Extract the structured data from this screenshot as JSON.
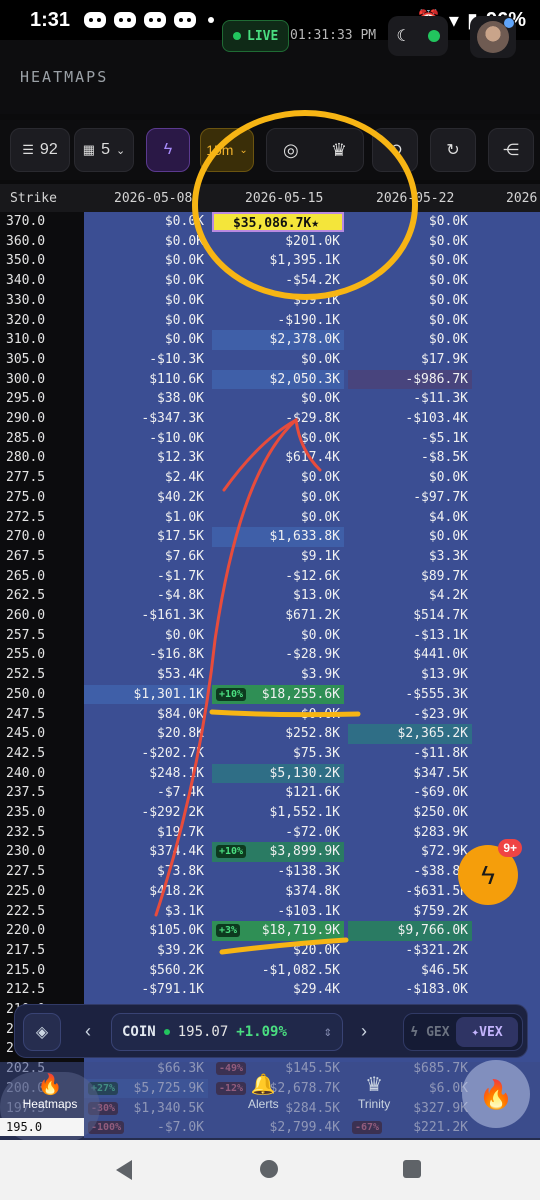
{
  "status_bar": {
    "time": "1:31",
    "battery": "96%"
  },
  "header": {
    "title": "HEATMAPS",
    "live_label": "LIVE",
    "clock": "01:31:33 PM"
  },
  "toolbar": {
    "count": "92",
    "days": "5",
    "timeframe": "15m"
  },
  "columns": {
    "strike": "Strike",
    "dates": [
      "2026-05-08",
      "2026-05-15",
      "2026-05-22",
      "2026"
    ]
  },
  "rows": [
    {
      "k": "370.0",
      "v": [
        "$0.0K",
        "$35,086.7K★",
        "$0.0K"
      ]
    },
    {
      "k": "360.0",
      "v": [
        "$0.0K",
        "$201.0K",
        "$0.0K"
      ]
    },
    {
      "k": "350.0",
      "v": [
        "$0.0K",
        "$1,395.1K",
        "$0.0K"
      ]
    },
    {
      "k": "340.0",
      "v": [
        "$0.0K",
        "-$54.2K",
        "$0.0K"
      ]
    },
    {
      "k": "330.0",
      "v": [
        "$0.0K",
        "$59.1K",
        "$0.0K"
      ]
    },
    {
      "k": "320.0",
      "v": [
        "$0.0K",
        "-$190.1K",
        "$0.0K"
      ]
    },
    {
      "k": "310.0",
      "v": [
        "$0.0K",
        "$2,378.0K",
        "$0.0K"
      ]
    },
    {
      "k": "305.0",
      "v": [
        "-$10.3K",
        "$0.0K",
        "$17.9K"
      ]
    },
    {
      "k": "300.0",
      "v": [
        "$110.6K",
        "$2,050.3K",
        "-$986.7K"
      ]
    },
    {
      "k": "295.0",
      "v": [
        "$38.0K",
        "$0.0K",
        "-$11.3K"
      ]
    },
    {
      "k": "290.0",
      "v": [
        "-$347.3K",
        "-$29.8K",
        "-$103.4K"
      ]
    },
    {
      "k": "285.0",
      "v": [
        "-$10.0K",
        "$0.0K",
        "-$5.1K"
      ]
    },
    {
      "k": "280.0",
      "v": [
        "$12.3K",
        "$617.4K",
        "-$8.5K"
      ]
    },
    {
      "k": "277.5",
      "v": [
        "$2.4K",
        "$0.0K",
        "$0.0K"
      ]
    },
    {
      "k": "275.0",
      "v": [
        "$40.2K",
        "$0.0K",
        "-$97.7K"
      ]
    },
    {
      "k": "272.5",
      "v": [
        "$1.0K",
        "$0.0K",
        "$4.0K"
      ]
    },
    {
      "k": "270.0",
      "v": [
        "$17.5K",
        "$1,633.8K",
        "$0.0K"
      ]
    },
    {
      "k": "267.5",
      "v": [
        "$7.6K",
        "$9.1K",
        "$3.3K"
      ]
    },
    {
      "k": "265.0",
      "v": [
        "-$1.7K",
        "-$12.6K",
        "$89.7K"
      ]
    },
    {
      "k": "262.5",
      "v": [
        "-$4.8K",
        "$13.0K",
        "$4.2K"
      ]
    },
    {
      "k": "260.0",
      "v": [
        "-$161.3K",
        "$671.2K",
        "$514.7K"
      ]
    },
    {
      "k": "257.5",
      "v": [
        "$0.0K",
        "$0.0K",
        "-$13.1K"
      ]
    },
    {
      "k": "255.0",
      "v": [
        "-$16.8K",
        "-$28.9K",
        "$441.0K"
      ]
    },
    {
      "k": "252.5",
      "v": [
        "$53.4K",
        "$3.9K",
        "$13.9K"
      ]
    },
    {
      "k": "250.0",
      "v": [
        "$1,301.1K",
        "$18,255.6K",
        "-$555.3K"
      ]
    },
    {
      "k": "247.5",
      "v": [
        "$84.0K",
        "$0.0K",
        "-$23.9K"
      ]
    },
    {
      "k": "245.0",
      "v": [
        "$20.8K",
        "$252.8K",
        "$2,365.2K"
      ]
    },
    {
      "k": "242.5",
      "v": [
        "-$202.7K",
        "$75.3K",
        "-$11.8K"
      ]
    },
    {
      "k": "240.0",
      "v": [
        "$248.1K",
        "$5,130.2K",
        "$347.5K"
      ]
    },
    {
      "k": "237.5",
      "v": [
        "-$7.4K",
        "$121.6K",
        "-$69.0K"
      ]
    },
    {
      "k": "235.0",
      "v": [
        "-$292.2K",
        "$1,552.1K",
        "$250.0K"
      ]
    },
    {
      "k": "232.5",
      "v": [
        "$19.7K",
        "-$72.0K",
        "$283.9K"
      ]
    },
    {
      "k": "230.0",
      "v": [
        "$374.4K",
        "$3,899.9K",
        "$72.9K"
      ]
    },
    {
      "k": "227.5",
      "v": [
        "$73.8K",
        "-$138.3K",
        "-$38.8K"
      ]
    },
    {
      "k": "225.0",
      "v": [
        "$418.2K",
        "$374.8K",
        "-$631.5K"
      ]
    },
    {
      "k": "222.5",
      "v": [
        "$3.1K",
        "-$103.1K",
        "$759.2K"
      ]
    },
    {
      "k": "220.0",
      "v": [
        "$105.0K",
        "$18,719.9K",
        "$9,766.0K"
      ]
    },
    {
      "k": "217.5",
      "v": [
        "$39.2K",
        "$20.0K",
        "-$321.2K"
      ]
    },
    {
      "k": "215.0",
      "v": [
        "$560.2K",
        "-$1,082.5K",
        "$46.5K"
      ]
    },
    {
      "k": "212.5",
      "v": [
        "-$791.1K",
        "$29.4K",
        "-$183.0K"
      ]
    },
    {
      "k": "210.0",
      "v": [
        "",
        "",
        ""
      ]
    },
    {
      "k": "207.5",
      "v": [
        "",
        "",
        ""
      ]
    },
    {
      "k": "205.0",
      "v": [
        "",
        "",
        ""
      ]
    },
    {
      "k": "202.5",
      "v": [
        "$66.3K",
        "$145.5K",
        "$685.7K"
      ]
    },
    {
      "k": "200.0",
      "v": [
        "$5,725.9K",
        "-$2,678.7K",
        "$6.0K"
      ]
    },
    {
      "k": "197.5",
      "v": [
        "$1,340.5K",
        "$284.5K",
        "$327.9K"
      ]
    },
    {
      "k": "195.0",
      "v": [
        "-$7.0K",
        "$2,799.4K",
        "$221.2K"
      ]
    }
  ],
  "badges": {
    "b250": "+10%",
    "b230": "+10%",
    "b220": "+3%",
    "b200a": "+27%",
    "b200b": "-12%",
    "b202": "-49%",
    "b197": "-30%",
    "b195a": "-100%",
    "b195b": "-67%"
  },
  "coin_bar": {
    "symbol": "COIN",
    "price": "195.07",
    "change": "+1.09%",
    "gex": "GEX",
    "vex": "VEX"
  },
  "bottom_nav": {
    "heatmaps": "Heatmaps",
    "alerts": "Alerts",
    "trinity": "Trinity"
  },
  "fab": {
    "notif_count": "9+"
  },
  "current_price": "195.0",
  "colors": {
    "grid_bg": "#3b4e93",
    "accent_green": "#22c55e",
    "accent_amber": "#f59e0b",
    "highlight_yellow": "#f4e53a"
  }
}
